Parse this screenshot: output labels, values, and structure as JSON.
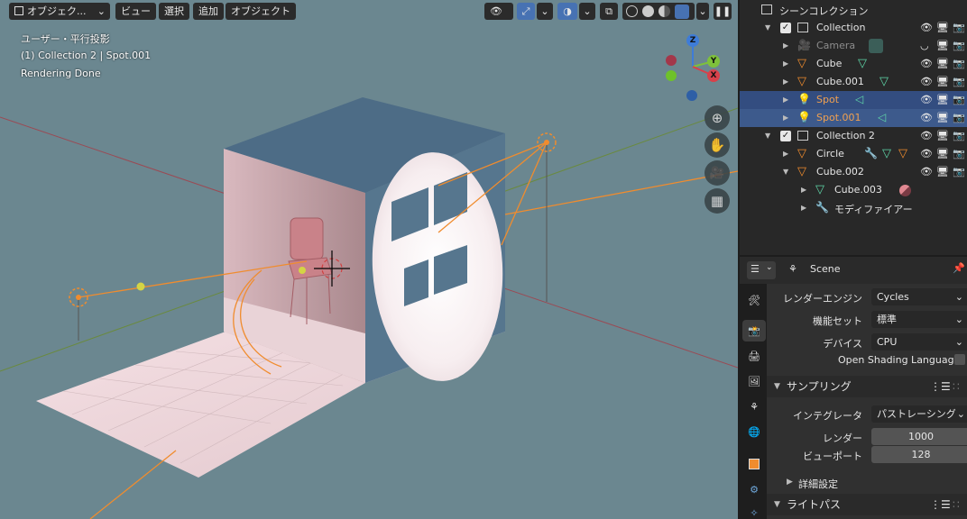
{
  "viewport": {
    "mode_label": "オブジェク...",
    "menu": [
      "ビュー",
      "選択",
      "追加",
      "オブジェクト"
    ],
    "overlay": {
      "view_name": "ユーザー・平行投影",
      "collection_info": "(1) Collection 2 | Spot.001",
      "status": "Rendering Done"
    },
    "gizmo": {
      "z": "Z",
      "y": "Y",
      "x": "X"
    }
  },
  "outliner": {
    "title": "シーンコレクション",
    "rows": [
      {
        "name": "Collection"
      },
      {
        "name": "Camera"
      },
      {
        "name": "Cube"
      },
      {
        "name": "Cube.001"
      },
      {
        "name": "Spot"
      },
      {
        "name": "Spot.001"
      },
      {
        "name": "Collection 2"
      },
      {
        "name": "Circle"
      },
      {
        "name": "Cube.002"
      },
      {
        "name": "Cube.003"
      },
      {
        "name": "モディファイアー"
      }
    ]
  },
  "properties": {
    "context": "Scene",
    "render_engine_label": "レンダーエンジン",
    "render_engine_value": "Cycles",
    "feature_set_label": "機能セット",
    "feature_set_value": "標準",
    "device_label": "デバイス",
    "device_value": "CPU",
    "osl_label": "Open Shading Language",
    "sampling_title": "サンプリング",
    "integrator_label": "インテグレータ",
    "integrator_value": "パストレーシング",
    "render_label": "レンダー",
    "render_value": "1000",
    "viewport_label": "ビューポート",
    "viewport_value": "128",
    "advanced_title": "詳細設定",
    "lightpath_title": "ライトパス"
  },
  "colors": {
    "viewport_bg": "#6b8790",
    "selection": "#334d80",
    "accent_orange": "#f08c2e",
    "object_green": "#5fd6a8",
    "active_blue": "#4772b3"
  }
}
